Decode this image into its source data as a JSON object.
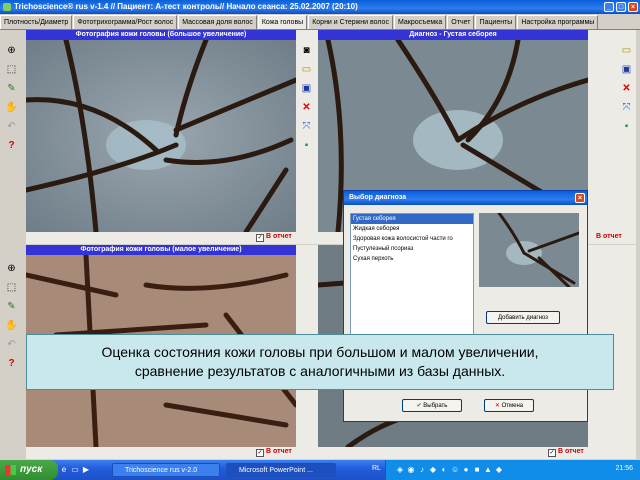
{
  "window": {
    "title": "Trichoscience® rus v-1.4 // Пациент: А-тест контроль// Начало сеанса: 25.02.2007 (20:10)"
  },
  "tabs": [
    {
      "label": "Плотность/Диаметр"
    },
    {
      "label": "Фототрихограмма/Рост волос"
    },
    {
      "label": "Массовая доля волос"
    },
    {
      "label": "Кожа головы"
    },
    {
      "label": "Корни и Стержни волос"
    },
    {
      "label": "Макросъемка"
    },
    {
      "label": "Отчет"
    },
    {
      "label": "Пациенты"
    },
    {
      "label": "Настройка программы"
    }
  ],
  "panels": {
    "tl": {
      "title": "Фотография кожи головы (большое увеличение)",
      "report_label": "В отчет"
    },
    "tr": {
      "title": "Диагноз - Густая себорея",
      "report_label": "В отчет"
    },
    "bl": {
      "title": "Фотография кожи головы (малое увеличение)",
      "report_label": "В отчет"
    },
    "br": {
      "report_label": "В отчет"
    }
  },
  "dialog": {
    "title": "Выбор диагноза",
    "items": [
      {
        "label": "Густая себорея"
      },
      {
        "label": "Жидкая себорея"
      },
      {
        "label": "Здоровая кожа волосистой части го"
      },
      {
        "label": "Пустулезный псориаз"
      },
      {
        "label": "Сухая перхоть"
      }
    ],
    "add_button": "Добавить диагноз",
    "select_button": "Выбрать",
    "cancel_button": "Отмена"
  },
  "caption": {
    "line1": "Оценка состояния кожи головы при большом и малом увеличении,",
    "line2": "сравнение результатов с аналогичными из базы данных."
  },
  "taskbar": {
    "start_label": "пуск",
    "tasks": [
      {
        "label": "Trichoscience rus v-2.0"
      },
      {
        "label": "Microsoft PowerPoint ..."
      }
    ],
    "language": "RL",
    "clock": "21:56"
  },
  "colors": {
    "panel_header": "#3434d6",
    "caption_bg": "#c9e8ee",
    "report_label": "#cc0000",
    "selection": "#3169c6"
  },
  "icons": [
    "crosshair-icon",
    "select-region-icon",
    "pipette-icon",
    "hand-icon",
    "undo-icon",
    "help-icon",
    "camera-icon",
    "folder-icon",
    "save-icon",
    "delete-icon",
    "fit-icon",
    "color-icon"
  ]
}
